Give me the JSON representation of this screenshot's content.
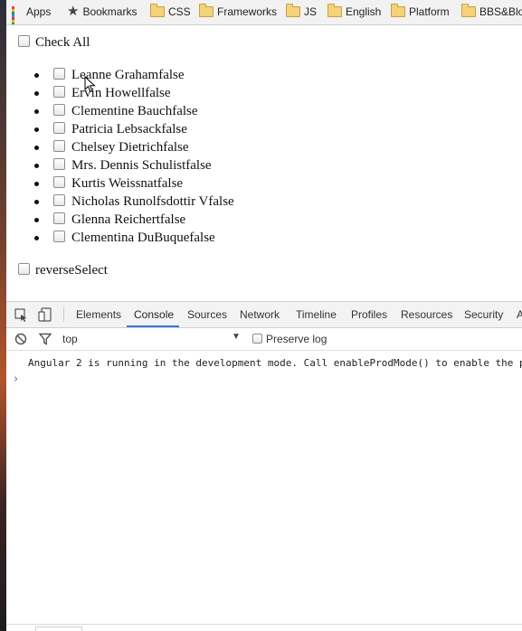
{
  "bookmarks": {
    "apps_label": "Apps",
    "bookmarks_label": "Bookmarks",
    "folders": [
      "CSS",
      "Frameworks",
      "JS",
      "English",
      "Platform",
      "BBS&Blo"
    ]
  },
  "page": {
    "check_all_label": "Check All",
    "users": [
      "Leanne Grahamfalse",
      "Ervin Howellfalse",
      "Clementine Bauchfalse",
      "Patricia Lebsackfalse",
      "Chelsey Dietrichfalse",
      "Mrs. Dennis Schulistfalse",
      "Kurtis Weissnatfalse",
      "Nicholas Runolfsdottir Vfalse",
      "Glenna Reichertfalse",
      "Clementina DuBuquefalse"
    ],
    "reverse_select_label": "reverseSelect"
  },
  "devtools": {
    "tabs": [
      "Elements",
      "Console",
      "Sources",
      "Network",
      "Timeline",
      "Profiles",
      "Resources",
      "Security",
      "A"
    ],
    "active_tab": "Console",
    "context_value": "top",
    "preserve_log_label": "Preserve log",
    "console_lines": [
      "Angular 2 is running in the development mode. Call enableProdMode() to enable the p"
    ],
    "prompt_symbol": "›"
  },
  "colors": {
    "accent": "#3879d9",
    "folder": "#f3d27a",
    "toolbar_bg": "#f3f3f3"
  }
}
